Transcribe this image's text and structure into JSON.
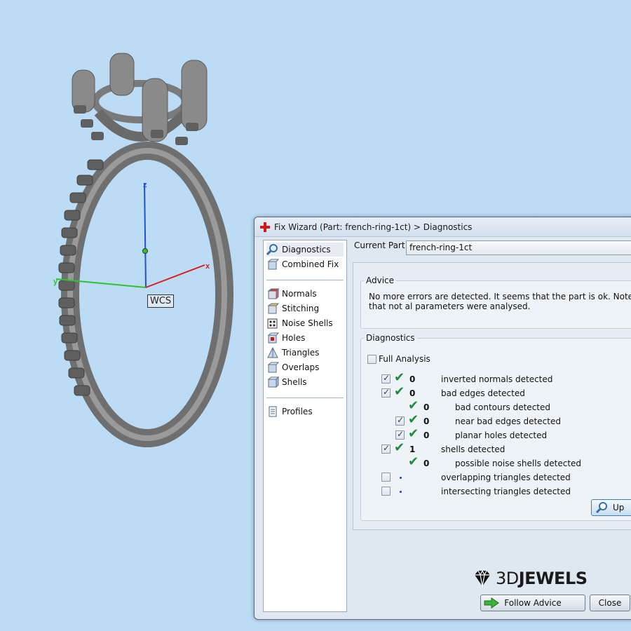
{
  "viewport": {
    "wcs_label": "WCS",
    "axes": {
      "x": "x",
      "y": "y",
      "z": "z"
    },
    "colors": {
      "background": "#bcdcf6",
      "x_axis": "#d91f1f",
      "y_axis": "#2fc42f",
      "z_axis": "#2050d8",
      "model": "#7d7d7d"
    }
  },
  "dialog": {
    "title": "Fix Wizard (Part: french-ring-1ct) > Diagnostics",
    "sidebar": {
      "items": [
        {
          "label": "Diagnostics",
          "icon": "magnifier-icon"
        },
        {
          "label": "Combined Fix",
          "icon": "cube-icon"
        },
        {
          "label": "Normals",
          "icon": "cube-red-icon"
        },
        {
          "label": "Stitching",
          "icon": "cube-stitch-icon"
        },
        {
          "label": "Noise Shells",
          "icon": "dice-icon"
        },
        {
          "label": "Holes",
          "icon": "cube-hole-icon"
        },
        {
          "label": "Triangles",
          "icon": "triangles-icon"
        },
        {
          "label": "Overlaps",
          "icon": "cube-overlap-icon"
        },
        {
          "label": "Shells",
          "icon": "cube-shells-icon"
        },
        {
          "label": "Profiles",
          "icon": "document-icon"
        }
      ]
    },
    "current_part_label": "Current Part:",
    "current_part_value": "french-ring-1ct",
    "advice": {
      "legend": "Advice",
      "text": "No more errors are detected. It seems that the part is ok. Note that not al parameters were analysed."
    },
    "diagnostics": {
      "legend": "Diagnostics",
      "full_analysis_label": "Full Analysis",
      "rows": [
        {
          "count": "0",
          "label": "inverted normals detected"
        },
        {
          "count": "0",
          "label": "bad edges detected"
        },
        {
          "count": "0",
          "label": "bad contours detected"
        },
        {
          "count": "0",
          "label": "near bad edges detected"
        },
        {
          "count": "0",
          "label": "planar holes detected"
        },
        {
          "count": "1",
          "label": "shells detected"
        },
        {
          "count": "0",
          "label": "possible noise shells detected"
        },
        {
          "count": "",
          "label": "overlapping triangles detected"
        },
        {
          "count": "",
          "label": "intersecting triangles detected"
        }
      ]
    },
    "update_button_label": "Up",
    "logo": {
      "prefix": "3D",
      "suffix": "JEWELS"
    },
    "follow_advice_label": "Follow Advice",
    "close_label": "Close"
  }
}
